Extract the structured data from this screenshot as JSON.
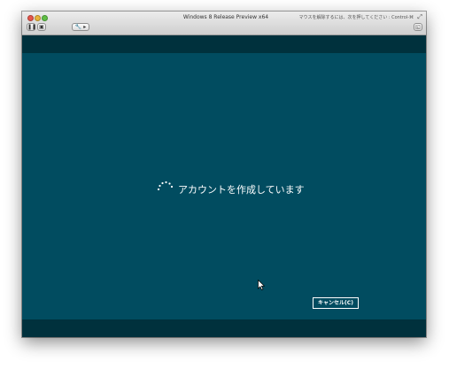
{
  "window": {
    "title": "Windows 8 Release Preview x64",
    "release_hint": "マウスを解除するには、次を押してください : Control-⌘",
    "toolbar": {
      "pause_icon": "pause-icon",
      "snapshot_icon": "snapshot-icon",
      "settings_icon": "wrench-icon",
      "screenshot_icon": "screenshot-icon"
    }
  },
  "vm_screen": {
    "status_text": "アカウントを作成しています",
    "cancel_label": "キャンセル(C)",
    "colors": {
      "background": "#014c60",
      "bar": "#00313d",
      "text": "#ffffff"
    }
  }
}
